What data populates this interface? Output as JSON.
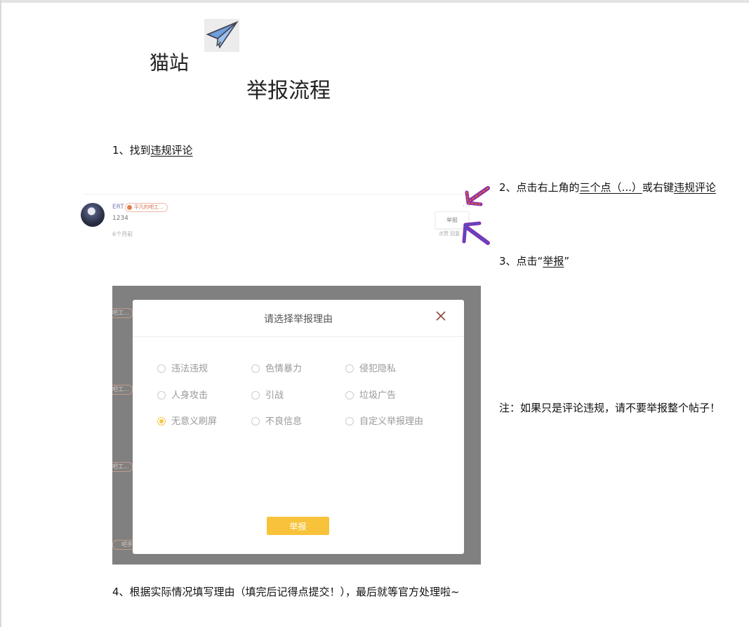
{
  "header": {
    "brand": "猫站",
    "title": "举报流程"
  },
  "steps": {
    "step1_prefix": "1、找到",
    "step1_link": "违规评论",
    "step2_prefix": "2、点击右上角的",
    "step2_link1": "三个点（...）",
    "step2_mid": "或右键",
    "step2_link2": "违规评论",
    "step3_prefix": "3、点击“",
    "step3_link": "举报",
    "step3_suffix": "”",
    "note": "注：如果只是评论违规，请不要举报整个帖子！",
    "step4": "4、根据实际情况填写理由（填完后记得点提交！），最后就等官方处理啦~"
  },
  "comment": {
    "user": "ERT",
    "badge": "平凡的吧工...",
    "text": "1234",
    "time": "6个月前",
    "menu_item": "举报",
    "dots": "···",
    "actions": "点赞  回复"
  },
  "dialog": {
    "title": "请选择举报理由",
    "submit_label": "举报",
    "side_stub": "吧工...",
    "side_stub_last": "吧手",
    "options": [
      {
        "label": "违法违规",
        "selected": false
      },
      {
        "label": "色情暴力",
        "selected": false
      },
      {
        "label": "侵犯隐私",
        "selected": false
      },
      {
        "label": "人身攻击",
        "selected": false
      },
      {
        "label": "引战",
        "selected": false
      },
      {
        "label": "垃圾广告",
        "selected": false
      },
      {
        "label": "无意义刷屏",
        "selected": true
      },
      {
        "label": "不良信息",
        "selected": false
      },
      {
        "label": "自定义举报理由",
        "selected": false
      }
    ]
  },
  "colors": {
    "accent": "#f8c33a",
    "arrow_purple": "#8a2fb0",
    "arrow_orange": "#e0602a",
    "overlay": "#808080"
  },
  "icons": [
    "paper-plane-icon",
    "close-icon",
    "arrow-icon"
  ]
}
